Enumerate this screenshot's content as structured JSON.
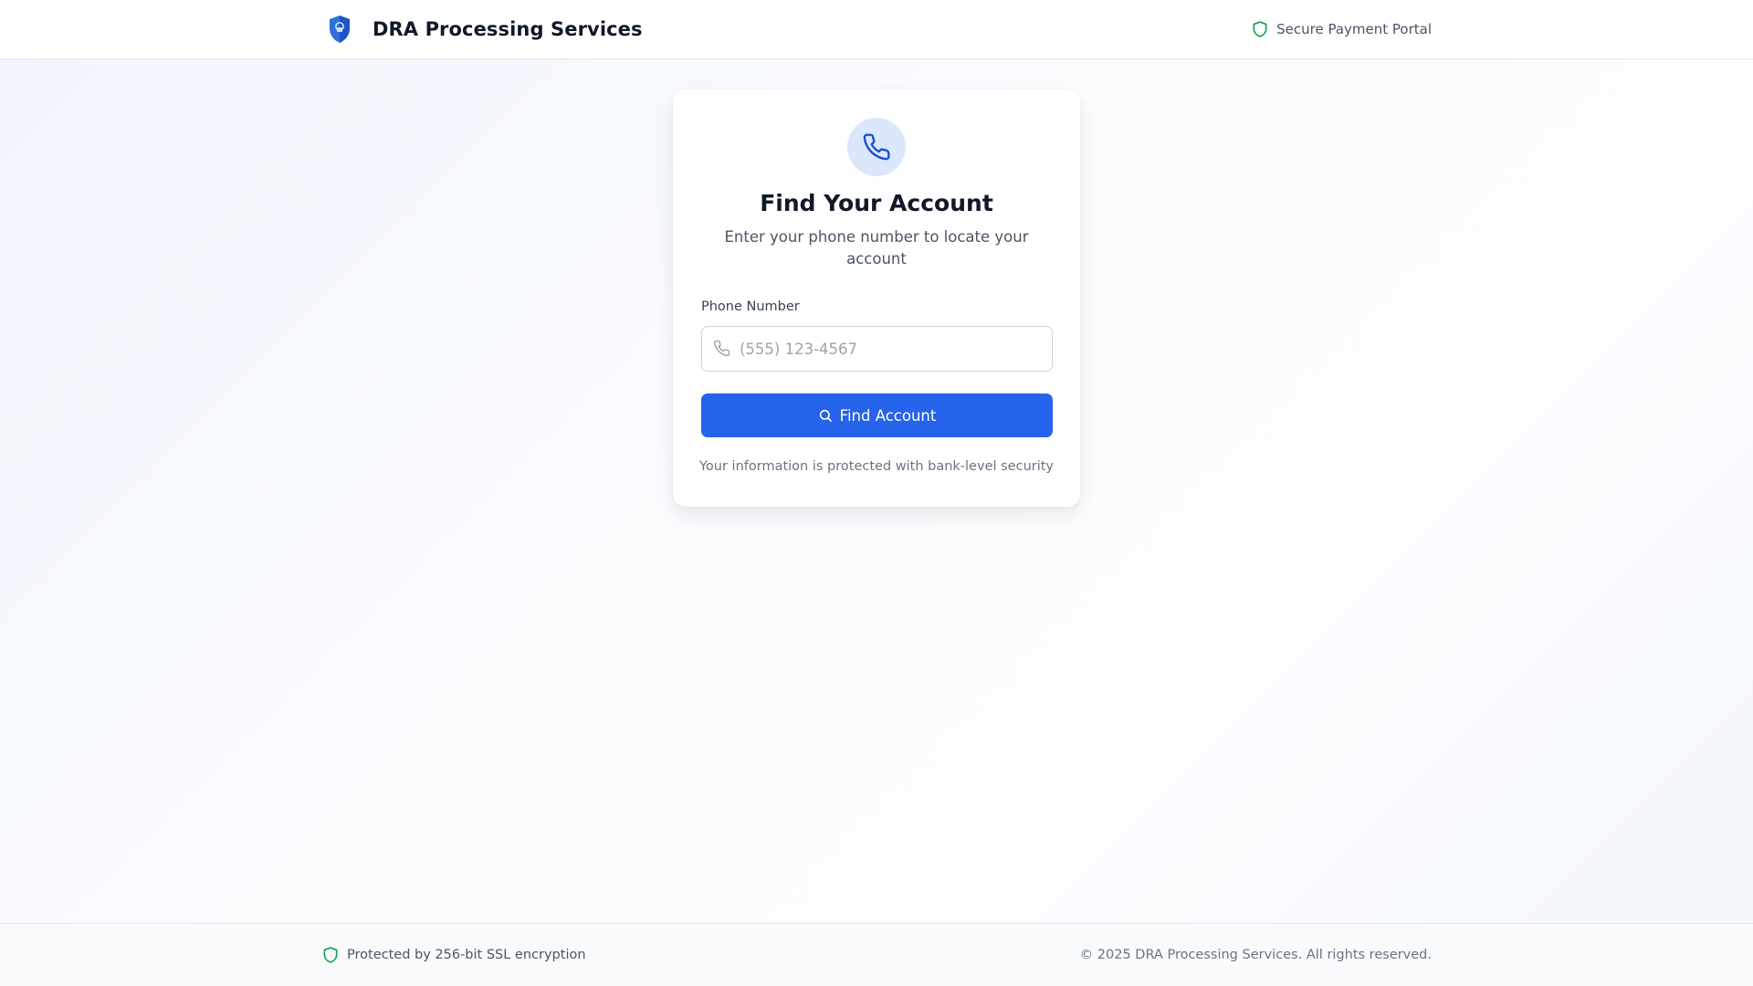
{
  "header": {
    "brand_title": "DRA Processing Services",
    "secure_label": "Secure Payment Portal",
    "logo_icon": "shield-lock-icon",
    "secure_icon": "shield-icon"
  },
  "card": {
    "icon": "phone-icon",
    "title": "Find Your Account",
    "subtitle": "Enter your phone number to locate your account",
    "phone_label": "Phone Number",
    "phone_value": "",
    "phone_placeholder": "(555) 123-4567",
    "button_label": "Find Account",
    "button_icon": "search-icon",
    "security_note": "Your information is protected with bank-level security"
  },
  "footer": {
    "ssl_label": "Protected by 256-bit SSL encryption",
    "ssl_icon": "shield-icon",
    "copyright": "© 2025 DRA Processing Services. All rights reserved."
  },
  "colors": {
    "primary": "#2563eb",
    "success": "#16a34a",
    "icon_bg": "#dbe8fb",
    "text": "#111827",
    "muted": "#6b7280"
  }
}
